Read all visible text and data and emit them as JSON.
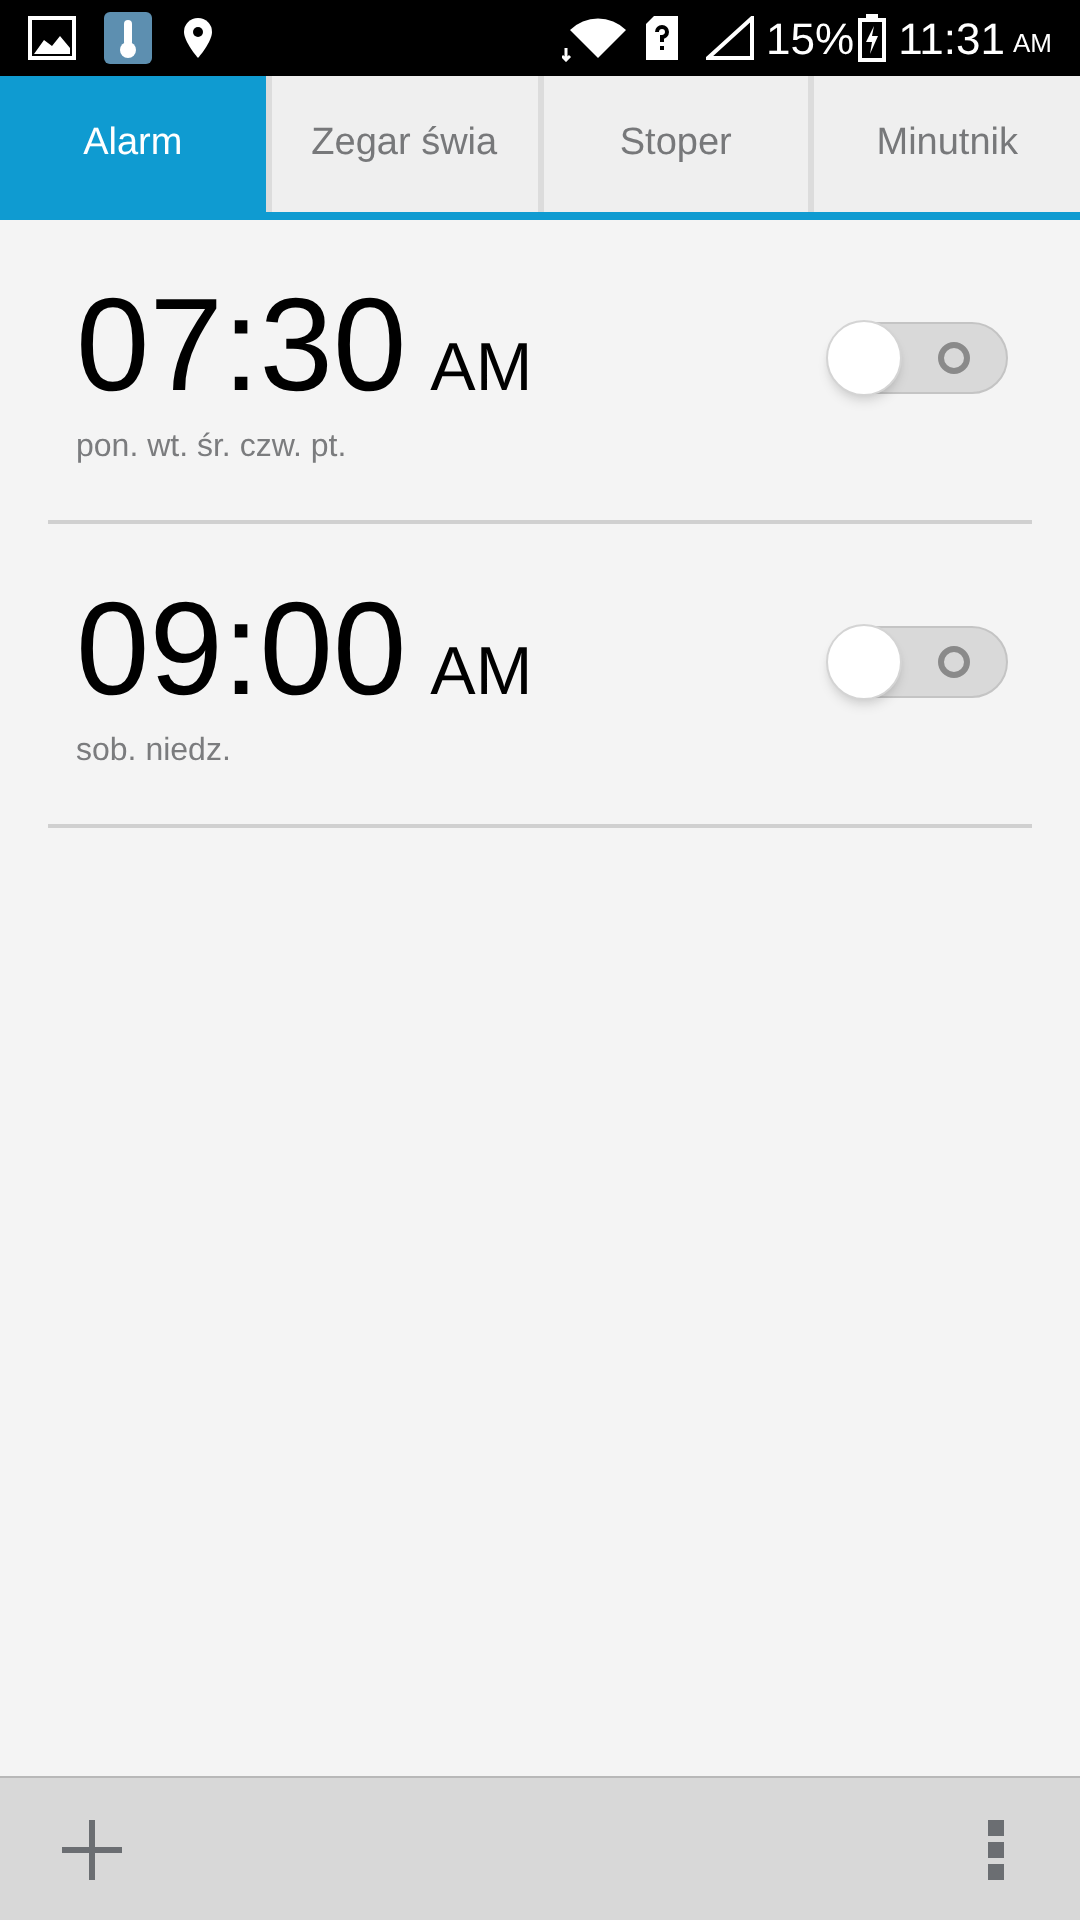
{
  "status_bar": {
    "battery": "15%",
    "time": "11:31",
    "time_suffix": "AM"
  },
  "tabs": [
    {
      "label": "Alarm",
      "selected": true
    },
    {
      "label": "Zegar świa",
      "selected": false
    },
    {
      "label": "Stoper",
      "selected": false
    },
    {
      "label": "Minutnik",
      "selected": false
    }
  ],
  "alarms": [
    {
      "time": "07:30",
      "period": "AM",
      "days": "pon. wt. śr. czw. pt.",
      "on": false
    },
    {
      "time": "09:00",
      "period": "AM",
      "days": "sob. niedz.",
      "on": false
    }
  ]
}
